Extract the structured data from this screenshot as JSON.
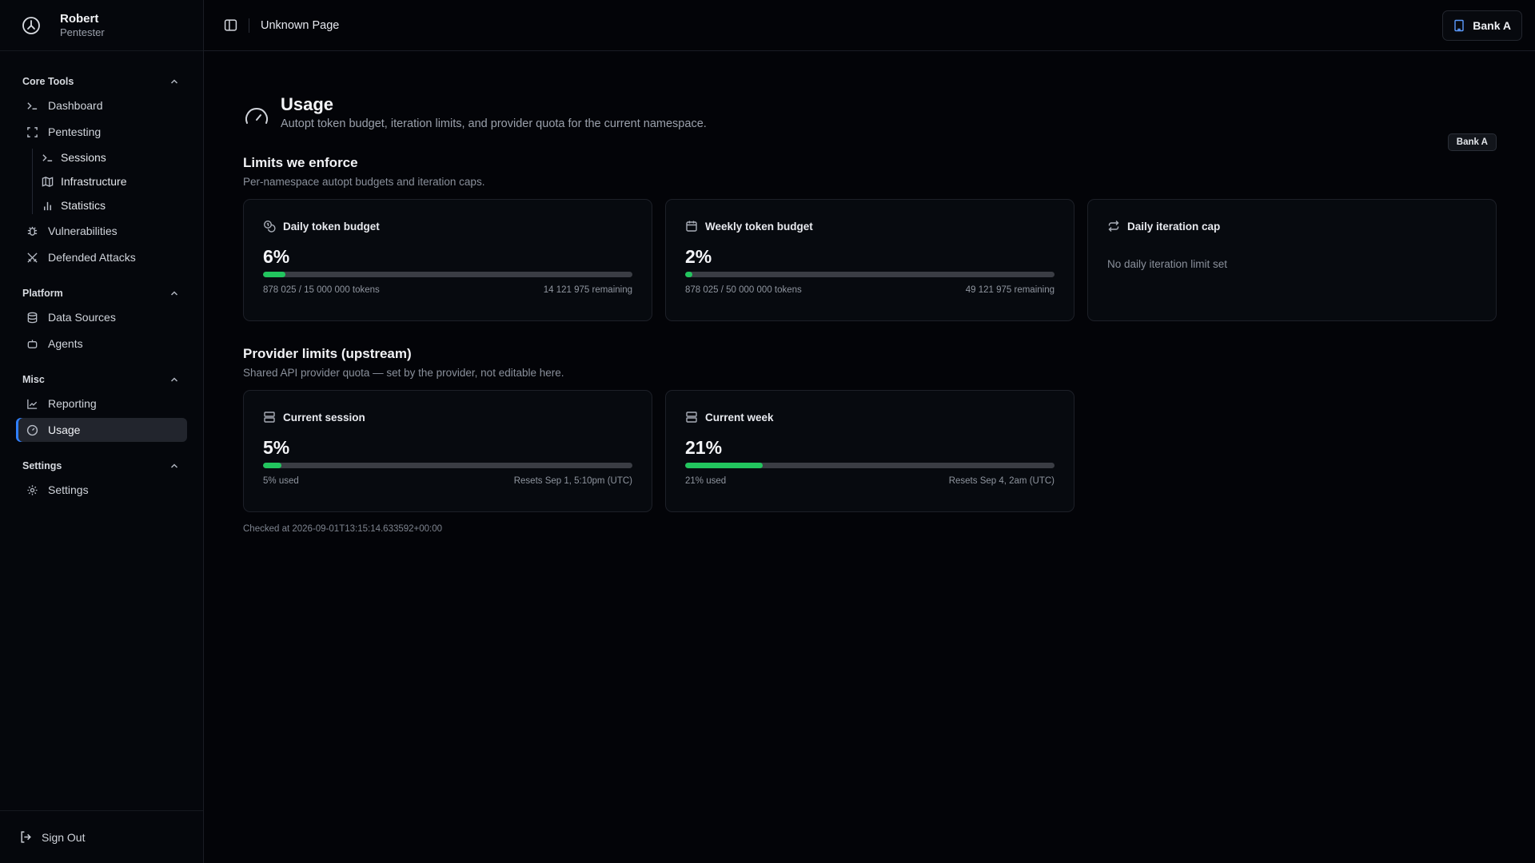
{
  "user": {
    "name": "Robert",
    "role": "Pentester"
  },
  "sidebar": {
    "groups": [
      {
        "label": "Core Tools"
      },
      {
        "label": "Platform"
      },
      {
        "label": "Misc"
      },
      {
        "label": "Settings"
      }
    ],
    "core": {
      "dashboard": "Dashboard",
      "pentesting": "Pentesting",
      "sessions": "Sessions",
      "infrastructure": "Infrastructure",
      "statistics": "Statistics",
      "vulnerabilities": "Vulnerabilities",
      "defended": "Defended Attacks"
    },
    "platform": {
      "data_sources": "Data Sources",
      "agents": "Agents"
    },
    "misc": {
      "reporting": "Reporting",
      "usage": "Usage"
    },
    "settings": {
      "settings": "Settings"
    },
    "sign_out": "Sign Out"
  },
  "topbar": {
    "breadcrumb": "Unknown Page",
    "namespace": "Bank A"
  },
  "page": {
    "title": "Usage",
    "subtitle": "Autopt token budget, iteration limits, and provider quota for the current namespace.",
    "namespace_badge": "Bank A"
  },
  "limits": {
    "title": "Limits we enforce",
    "subtitle": "Per-namespace autopt budgets and iteration caps.",
    "cards": [
      {
        "title": "Daily token budget",
        "percent_label": "6%",
        "fill_percent": 6,
        "left": "878 025 / 15 000 000 tokens",
        "right": "14 121 975 remaining"
      },
      {
        "title": "Weekly token budget",
        "percent_label": "2%",
        "fill_percent": 2,
        "left": "878 025 / 50 000 000 tokens",
        "right": "49 121 975 remaining"
      },
      {
        "title": "Daily iteration cap",
        "empty": "No daily iteration limit set"
      }
    ]
  },
  "provider": {
    "title": "Provider limits (upstream)",
    "subtitle": "Shared API provider quota — set by the provider, not editable here.",
    "cards": [
      {
        "title": "Current session",
        "percent_label": "5%",
        "fill_percent": 5,
        "left": "5% used",
        "right": "Resets Sep 1, 5:10pm (UTC)"
      },
      {
        "title": "Current week",
        "percent_label": "21%",
        "fill_percent": 21,
        "left": "21% used",
        "right": "Resets Sep 4, 2am (UTC)"
      }
    ]
  },
  "checked_at": "Checked at 2026-09-01T13:15:14.633592+00:00",
  "colors": {
    "accent": "#2f7fff",
    "progress": "#22c55e",
    "track": "#3a3d44",
    "background": "#030408"
  }
}
